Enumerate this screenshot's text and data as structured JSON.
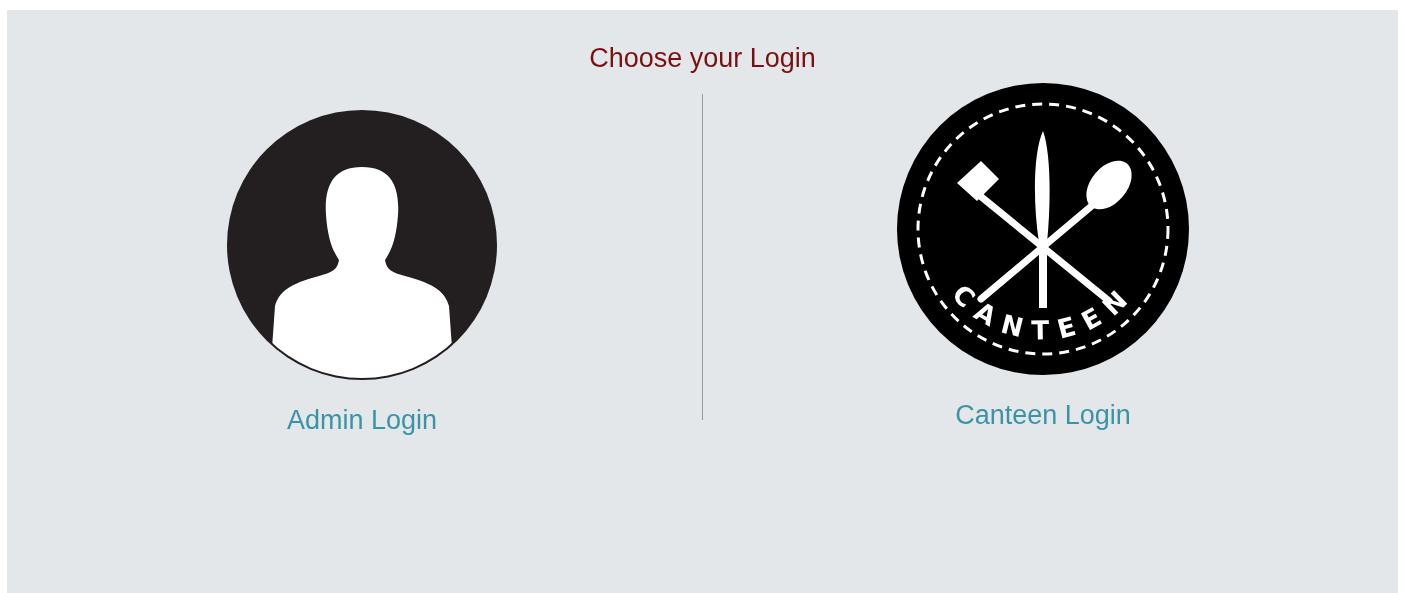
{
  "title": "Choose your Login",
  "options": [
    {
      "kind": "person",
      "label": "Admin Login"
    },
    {
      "kind": "cutlery",
      "label": "Canteen Login",
      "logo_text": "CANTEEN"
    }
  ]
}
